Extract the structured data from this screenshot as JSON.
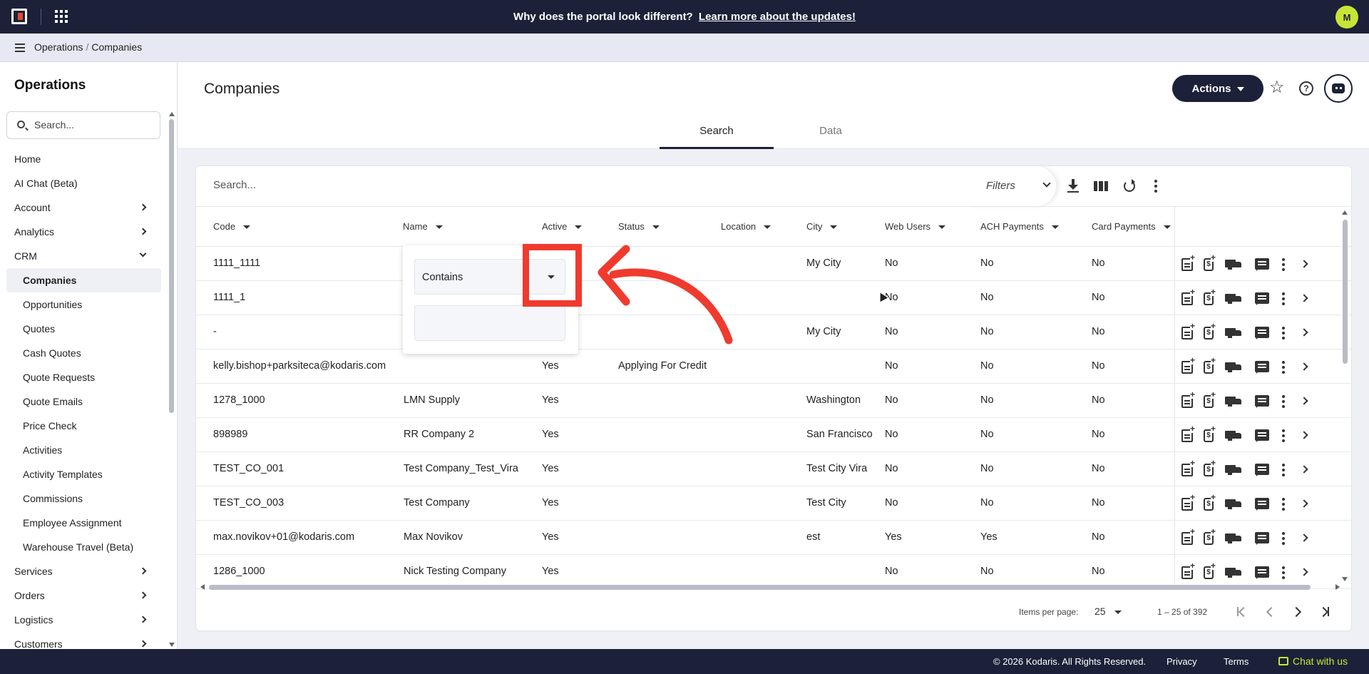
{
  "topbar": {
    "banner_text": "Why does the portal look different?",
    "banner_link": "Learn more about the updates!",
    "user_initial": "M"
  },
  "breadcrumb": {
    "root": "Operations",
    "separator": "/",
    "current": "Companies"
  },
  "sidebar": {
    "title": "Operations",
    "search_placeholder": "Search...",
    "items": [
      {
        "label": "Home"
      },
      {
        "label": "AI Chat (Beta)"
      },
      {
        "label": "Account",
        "expandable": true
      },
      {
        "label": "Analytics",
        "expandable": true
      },
      {
        "label": "CRM",
        "expanded": true
      },
      {
        "label": "Companies",
        "sub": true,
        "active": true
      },
      {
        "label": "Opportunities",
        "sub": true
      },
      {
        "label": "Quotes",
        "sub": true
      },
      {
        "label": "Cash Quotes",
        "sub": true
      },
      {
        "label": "Quote Requests",
        "sub": true
      },
      {
        "label": "Quote Emails",
        "sub": true
      },
      {
        "label": "Price Check",
        "sub": true
      },
      {
        "label": "Activities",
        "sub": true
      },
      {
        "label": "Activity Templates",
        "sub": true
      },
      {
        "label": "Commissions",
        "sub": true
      },
      {
        "label": "Employee Assignment",
        "sub": true
      },
      {
        "label": "Warehouse Travel (Beta)",
        "sub": true
      },
      {
        "label": "Services",
        "expandable": true
      },
      {
        "label": "Orders",
        "expandable": true
      },
      {
        "label": "Logistics",
        "expandable": true
      },
      {
        "label": "Customers",
        "expandable": true
      }
    ]
  },
  "header": {
    "title": "Companies",
    "actions_label": "Actions",
    "tabs": [
      {
        "label": "Search"
      },
      {
        "label": "Data"
      }
    ]
  },
  "table": {
    "search_placeholder": "Search...",
    "filters_label": "Filters",
    "columns": [
      {
        "label": "Code"
      },
      {
        "label": "Name"
      },
      {
        "label": "Active"
      },
      {
        "label": "Status"
      },
      {
        "label": "Location"
      },
      {
        "label": "City"
      },
      {
        "label": "Web Users"
      },
      {
        "label": "ACH Payments"
      },
      {
        "label": "Card Payments"
      }
    ],
    "rows": [
      {
        "code": "1111_1111",
        "name": "",
        "active": "",
        "status": "",
        "location": "",
        "city": "My City",
        "web_users": "No",
        "ach": "No",
        "card": "No"
      },
      {
        "code": "1111_1",
        "name": "",
        "active": "",
        "status": "",
        "location": "",
        "city": "",
        "web_users": "No",
        "ach": "No",
        "card": "No"
      },
      {
        "code": "-",
        "name": "",
        "active": "",
        "status": "",
        "location": "",
        "city": "My City",
        "web_users": "No",
        "ach": "No",
        "card": "No"
      },
      {
        "code": "kelly.bishop+parksiteca@kodaris.com",
        "name": "",
        "active": "Yes",
        "status": "Applying For Credit",
        "location": "",
        "city": "",
        "web_users": "No",
        "ach": "No",
        "card": "No"
      },
      {
        "code": "1278_1000",
        "name": "LMN Supply",
        "active": "Yes",
        "status": "",
        "location": "",
        "city": "Washington",
        "web_users": "No",
        "ach": "No",
        "card": "No"
      },
      {
        "code": "898989",
        "name": "RR Company 2",
        "active": "Yes",
        "status": "",
        "location": "",
        "city": "San Francisco",
        "web_users": "No",
        "ach": "No",
        "card": "No"
      },
      {
        "code": "TEST_CO_001",
        "name": "Test Company_Test_Vira",
        "active": "Yes",
        "status": "",
        "location": "",
        "city": "Test City Vira",
        "web_users": "No",
        "ach": "No",
        "card": "No"
      },
      {
        "code": "TEST_CO_003",
        "name": "Test Company",
        "active": "Yes",
        "status": "",
        "location": "",
        "city": "Test City",
        "web_users": "No",
        "ach": "No",
        "card": "No"
      },
      {
        "code": "max.novikov+01@kodaris.com",
        "name": "Max Novikov",
        "active": "Yes",
        "status": "",
        "location": "",
        "city": "est",
        "web_users": "Yes",
        "ach": "Yes",
        "card": "No"
      },
      {
        "code": "1286_1000",
        "name": "Nick Testing Company",
        "active": "Yes",
        "status": "",
        "location": "",
        "city": "",
        "web_users": "No",
        "ach": "No",
        "card": "No"
      }
    ],
    "row_icons": [
      "note-add-icon",
      "money-add-icon",
      "truck-icon",
      "comment-icon",
      "more-vert-icon",
      "chevron-right-icon"
    ]
  },
  "filter_popup": {
    "operator": "Contains",
    "value": ""
  },
  "paginator": {
    "items_per_page_label": "Items per page:",
    "items_per_page": "25",
    "range": "1 – 25 of 392"
  },
  "footer": {
    "copyright": "© 2026 Kodaris. All Rights Reserved.",
    "privacy": "Privacy",
    "terms": "Terms",
    "chat": "Chat with us"
  },
  "colors": {
    "navy": "#1c2139",
    "accent_lime": "#c7e535",
    "annotation_red": "#f03a2e"
  }
}
